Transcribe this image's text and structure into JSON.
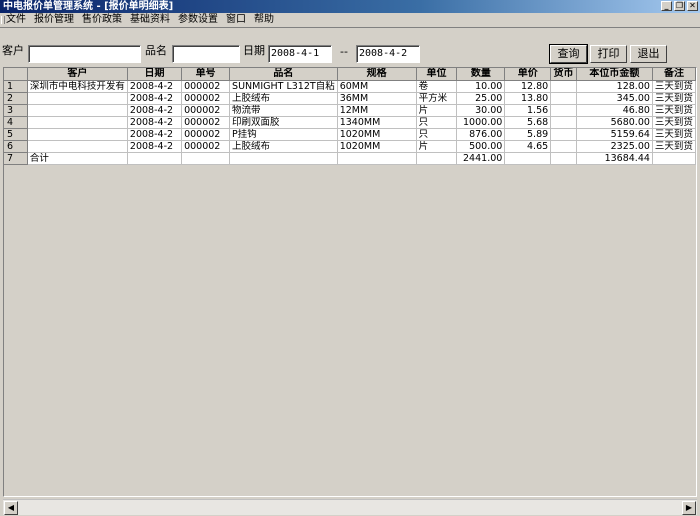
{
  "window": {
    "title": "中电报价单管理系统 - [报价单明细表]"
  },
  "menu": [
    "文件",
    "报价管理",
    "售价政策",
    "基础资料",
    "参数设置",
    "窗口",
    "帮助"
  ],
  "filters": {
    "customer_label": "客户",
    "customer_value": "",
    "product_label": "品名",
    "product_value": "",
    "date_label": "日期",
    "date_from": "2008-4-1",
    "date_sep": "--",
    "date_to": "2008-4-2"
  },
  "buttons": {
    "query": "查询",
    "print": "打印",
    "exit": "退出"
  },
  "window_buttons": {
    "minimize": "_",
    "restore": "❐",
    "close": "✕"
  },
  "table": {
    "headers": [
      "客户",
      "日期",
      "单号",
      "品名",
      "规格",
      "单位",
      "数量",
      "单价",
      "货币",
      "本位币金额",
      "备注"
    ],
    "rows": [
      {
        "n": "1",
        "customer": "深圳市中电科技开发有",
        "date": "2008-4-2",
        "no": "000002",
        "product": "SUNMIGHT  L312T自粘",
        "spec": "60MM",
        "unit": "卷",
        "qty": "10.00",
        "price": "12.80",
        "currency": "",
        "amount": "128.00",
        "note": "三天到货"
      },
      {
        "n": "2",
        "customer": "",
        "date": "2008-4-2",
        "no": "000002",
        "product": "上胶绒布",
        "spec": "36MM",
        "unit": "平方米",
        "qty": "25.00",
        "price": "13.80",
        "currency": "",
        "amount": "345.00",
        "note": "三天到货"
      },
      {
        "n": "3",
        "customer": "",
        "date": "2008-4-2",
        "no": "000002",
        "product": "物流带",
        "spec": "12MM",
        "unit": "片",
        "qty": "30.00",
        "price": "1.56",
        "currency": "",
        "amount": "46.80",
        "note": "三天到货"
      },
      {
        "n": "4",
        "customer": "",
        "date": "2008-4-2",
        "no": "000002",
        "product": "印刷双面胶",
        "spec": "1340MM",
        "unit": "只",
        "qty": "1000.00",
        "price": "5.68",
        "currency": "",
        "amount": "5680.00",
        "note": "三天到货"
      },
      {
        "n": "5",
        "customer": "",
        "date": "2008-4-2",
        "no": "000002",
        "product": "P挂钩",
        "spec": "1020MM",
        "unit": "只",
        "qty": "876.00",
        "price": "5.89",
        "currency": "",
        "amount": "5159.64",
        "note": "三天到货"
      },
      {
        "n": "6",
        "customer": "",
        "date": "2008-4-2",
        "no": "000002",
        "product": "上胶绒布",
        "spec": "1020MM",
        "unit": "片",
        "qty": "500.00",
        "price": "4.65",
        "currency": "",
        "amount": "2325.00",
        "note": "三天到货"
      },
      {
        "n": "7",
        "customer": "合计",
        "date": "",
        "no": "",
        "product": "",
        "spec": "",
        "unit": "",
        "qty": "2441.00",
        "price": "",
        "currency": "",
        "amount": "13684.44",
        "note": ""
      }
    ]
  },
  "scrollbar": {
    "left_arrow": "◀",
    "right_arrow": "▶"
  }
}
